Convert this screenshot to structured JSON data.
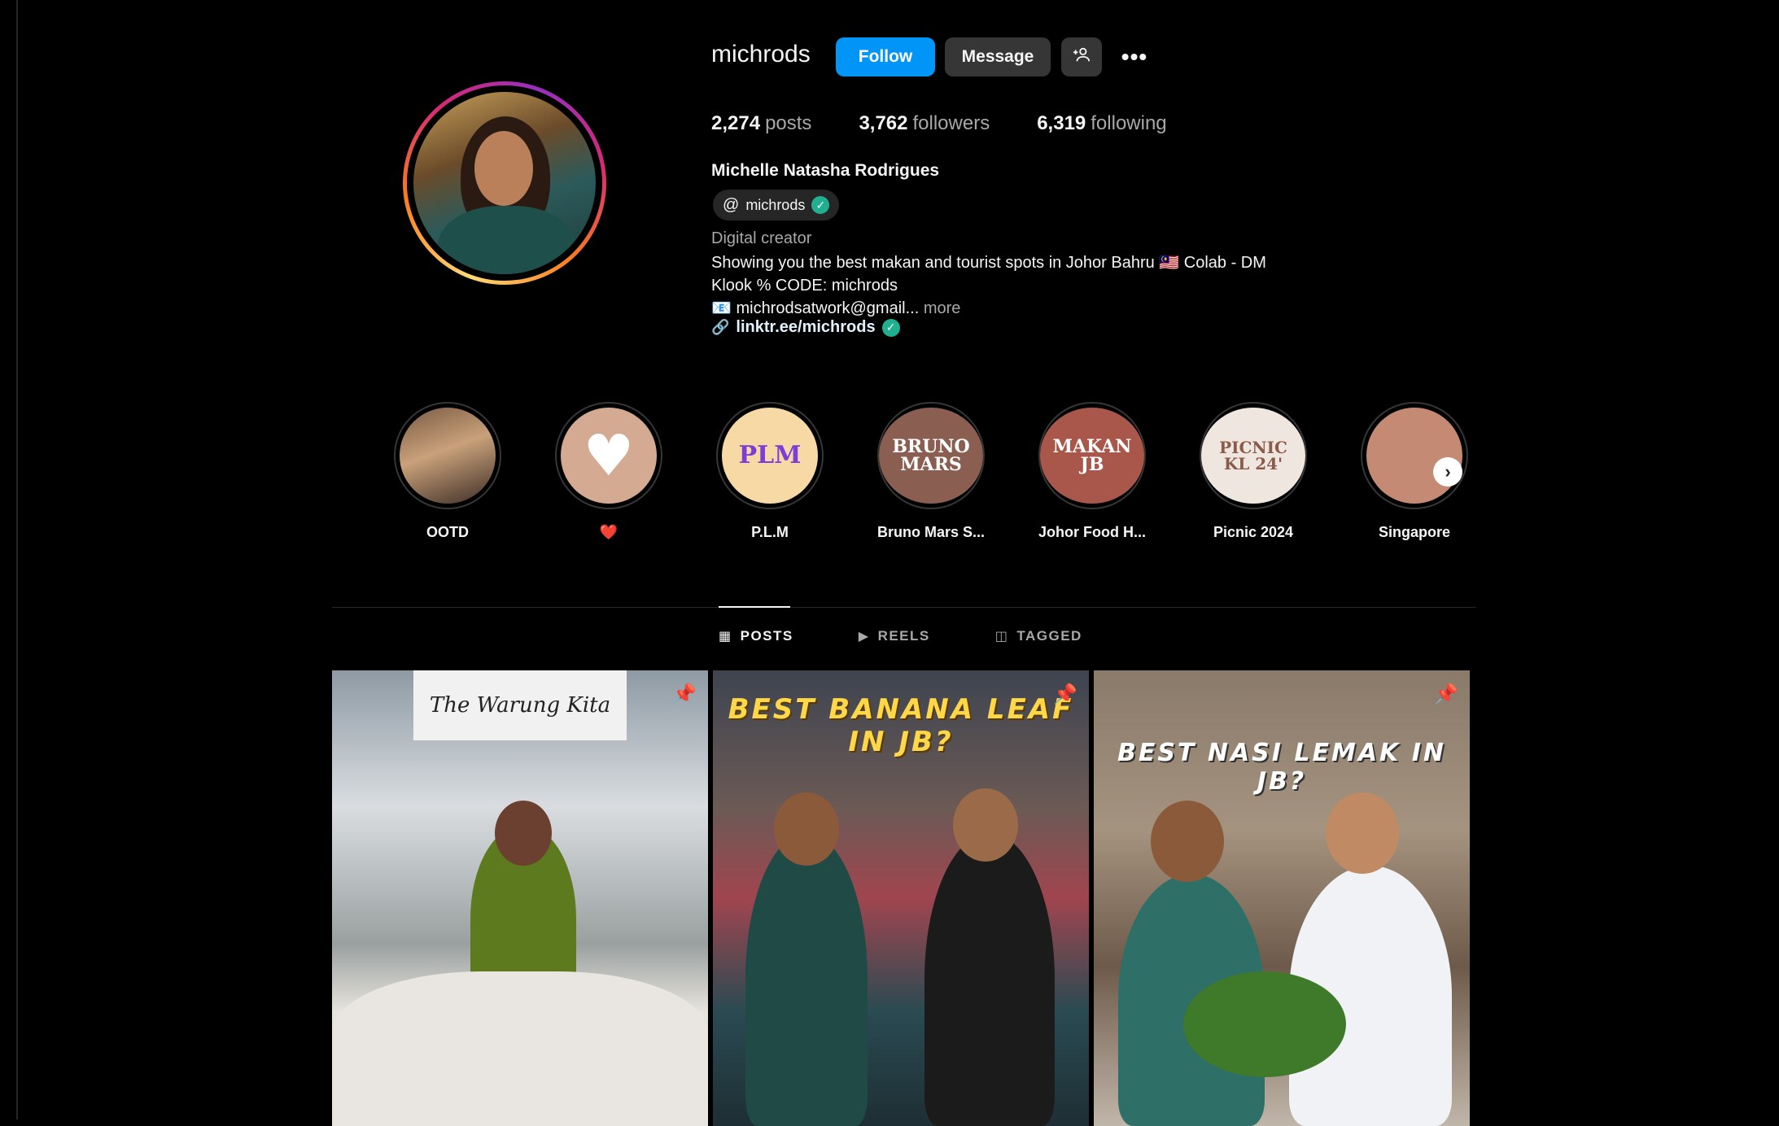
{
  "profile": {
    "username": "michrods",
    "full_name": "Michelle Natasha Rodrigues",
    "threads_handle": "michrods",
    "category": "Digital creator",
    "bio_lines": [
      "Showing you the best makan and tourist spots in Johor Bahru 🇲🇾 Colab - DM",
      "Klook % CODE: michrods",
      "📧 michrodsatwork@gmail..."
    ],
    "more_label": "more",
    "link": "linktr.ee/michrods"
  },
  "actions": {
    "follow": "Follow",
    "message": "Message",
    "add_user_icon": "add-user-icon",
    "more_icon": "more-options-icon"
  },
  "stats": {
    "posts_count": "2,274",
    "posts_label": "posts",
    "followers_count": "3,762",
    "followers_label": "followers",
    "following_count": "6,319",
    "following_label": "following"
  },
  "highlights": [
    {
      "label": "OOTD",
      "cover_text": ""
    },
    {
      "label": "❤️",
      "cover_text": "♥"
    },
    {
      "label": "P.L.M",
      "cover_text": "PLM"
    },
    {
      "label": "Bruno Mars S...",
      "cover_text": "BRUNO MARS"
    },
    {
      "label": "Johor Food H...",
      "cover_text": "MAKAN JB"
    },
    {
      "label": "Picnic 2024",
      "cover_text": "PICNIC KL 24'"
    },
    {
      "label": "Singapore",
      "cover_text": ""
    }
  ],
  "tabs": [
    {
      "label": "POSTS",
      "icon": "grid-icon",
      "active": true
    },
    {
      "label": "REELS",
      "icon": "reels-icon",
      "active": false
    },
    {
      "label": "TAGGED",
      "icon": "tagged-icon",
      "active": false
    }
  ],
  "posts": [
    {
      "overlay_text": "The Warung Kita",
      "pinned": true
    },
    {
      "overlay_text": "BEST BANANA LEAF IN JB?",
      "pinned": true
    },
    {
      "overlay_text": "BEST NASI LEMAK IN JB?",
      "pinned": true
    }
  ],
  "colors": {
    "background": "#000000",
    "follow_button": "#0095f6",
    "secondary_button": "#363636",
    "verified": "#21b08f",
    "muted_text": "#a8a8a8"
  }
}
